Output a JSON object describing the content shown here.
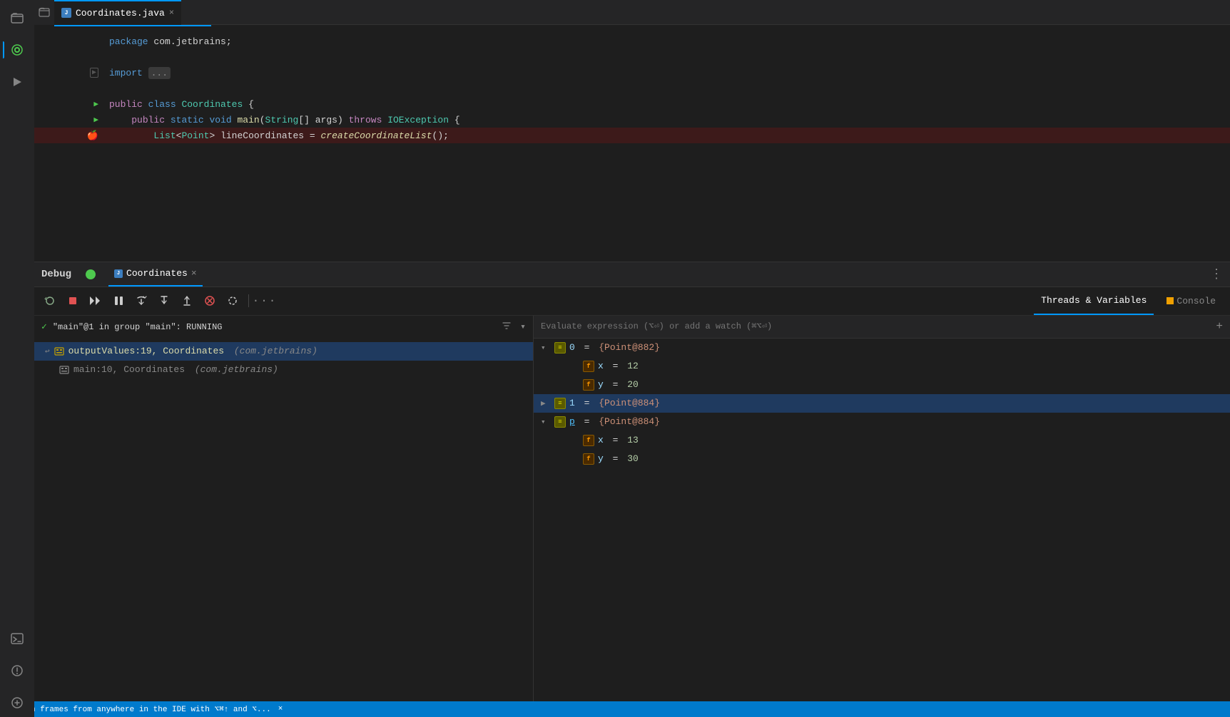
{
  "editor": {
    "tab": {
      "filename": "Coordinates.java",
      "icon": "java",
      "active": true
    },
    "code_lines": [
      {
        "id": 1,
        "indent": "",
        "content": "package com.jetbrains;",
        "style": "package"
      },
      {
        "id": 2,
        "indent": "",
        "content": "",
        "style": ""
      },
      {
        "id": 3,
        "indent": "",
        "content": "import ...",
        "style": "import-collapsed",
        "has_arrow": true
      },
      {
        "id": 4,
        "indent": "",
        "content": "",
        "style": ""
      },
      {
        "id": 5,
        "indent": "",
        "content": "public class Coordinates {",
        "style": "class",
        "has_run": true
      },
      {
        "id": 6,
        "indent": "    ",
        "content": "public static void main(String[] args) throws IOException {",
        "style": "method",
        "has_run": true
      },
      {
        "id": 7,
        "indent": "        ",
        "content": "List<Point> lineCoordinates = createCoordinateList();",
        "style": "highlighted",
        "has_breakpoint": true
      }
    ]
  },
  "debug_panel": {
    "title": "Debug",
    "tab_icon": "debug-green",
    "coordinates_tab": "Coordinates",
    "toolbar": {
      "buttons": [
        {
          "name": "rerun",
          "symbol": "↺",
          "tooltip": "Rerun"
        },
        {
          "name": "stop",
          "symbol": "■",
          "tooltip": "Stop"
        },
        {
          "name": "resume",
          "symbol": "▶▶",
          "tooltip": "Resume Program"
        },
        {
          "name": "pause",
          "symbol": "⏸",
          "tooltip": "Pause"
        },
        {
          "name": "step-over",
          "symbol": "⤵",
          "tooltip": "Step Over"
        },
        {
          "name": "step-into",
          "symbol": "⬇",
          "tooltip": "Step Into"
        },
        {
          "name": "step-out",
          "symbol": "⬆",
          "tooltip": "Step Out"
        },
        {
          "name": "stop-alt",
          "symbol": "⊘",
          "tooltip": "Stop"
        },
        {
          "name": "mute",
          "symbol": "⚡",
          "tooltip": "Mute Breakpoints"
        },
        {
          "name": "more",
          "symbol": "⋯",
          "tooltip": "More"
        }
      ]
    },
    "threads_tab_label": "Threads & Variables",
    "console_tab_label": "Console",
    "thread": {
      "status_icon": "✓",
      "name": "\"main\"@1 in group \"main\": RUNNING"
    },
    "frames": [
      {
        "id": 0,
        "method": "outputValues:19, Coordinates",
        "location": "(com.jetbrains)",
        "selected": true,
        "has_back_arrow": true
      },
      {
        "id": 1,
        "method": "main:10, Coordinates",
        "location": "(com.jetbrains)",
        "selected": false
      }
    ],
    "eval_placeholder": "Evaluate expression (⌥⏎) or add a watch (⌘⌥⏎)",
    "variables": [
      {
        "indent": 0,
        "expanded": true,
        "icon": "array",
        "name": "0",
        "eq": "=",
        "value": "{Point@882}",
        "children": [
          {
            "indent": 1,
            "expanded": false,
            "icon": "field",
            "name": "x",
            "eq": "=",
            "value": "12"
          },
          {
            "indent": 1,
            "expanded": false,
            "icon": "field",
            "name": "y",
            "eq": "=",
            "value": "20"
          }
        ]
      },
      {
        "indent": 0,
        "expanded": false,
        "icon": "array",
        "name": "1",
        "eq": "=",
        "value": "{Point@884}",
        "children": []
      },
      {
        "indent": 0,
        "expanded": true,
        "icon": "array",
        "name": "p",
        "eq": "=",
        "value": "{Point@884}",
        "is_highlight": true,
        "children": [
          {
            "indent": 1,
            "expanded": false,
            "icon": "field",
            "name": "x",
            "eq": "=",
            "value": "13"
          },
          {
            "indent": 1,
            "expanded": false,
            "icon": "field",
            "name": "y",
            "eq": "=",
            "value": "30"
          }
        ]
      }
    ]
  },
  "sidebar": {
    "items": [
      {
        "name": "folder",
        "icon": "📁",
        "active": false
      },
      {
        "name": "debug",
        "icon": "🐛",
        "active": true
      },
      {
        "name": "run",
        "icon": "▶",
        "active": false
      },
      {
        "name": "terminal",
        "icon": "⌨",
        "active": false
      },
      {
        "name": "plugins",
        "icon": "🔌",
        "active": false
      }
    ]
  },
  "status_bar": {
    "message": "Switch frames from anywhere in the IDE with ⌥⌘↑ and ⌥...",
    "close": "×"
  }
}
